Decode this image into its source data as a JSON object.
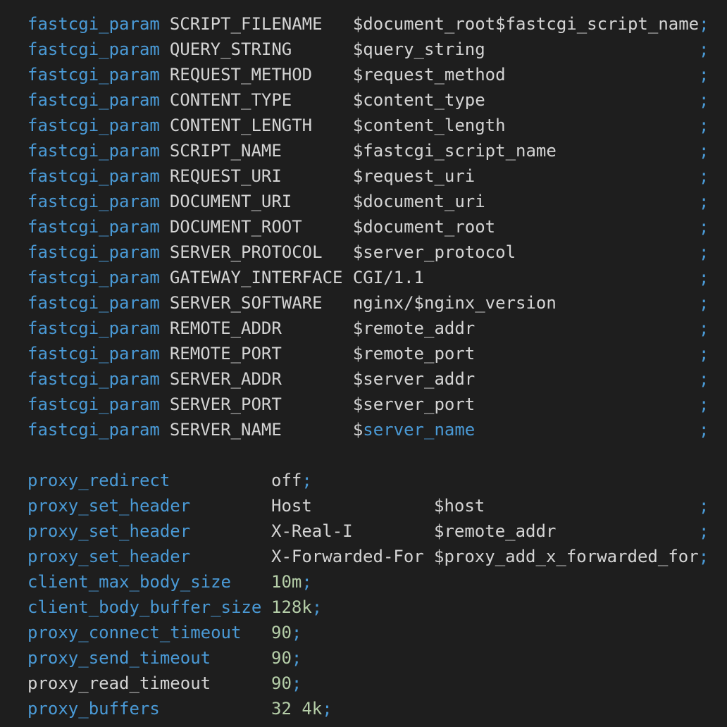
{
  "fastcgi_lines": [
    {
      "directive": "fastcgi_param",
      "name": "SCRIPT_FILENAME",
      "value": "$document_root$fastcgi_script_name",
      "semi": ";"
    },
    {
      "directive": "fastcgi_param",
      "name": "QUERY_STRING",
      "value": "$query_string",
      "semi": ";"
    },
    {
      "directive": "fastcgi_param",
      "name": "REQUEST_METHOD",
      "value": "$request_method",
      "semi": ";"
    },
    {
      "directive": "fastcgi_param",
      "name": "CONTENT_TYPE",
      "value": "$content_type",
      "semi": ";"
    },
    {
      "directive": "fastcgi_param",
      "name": "CONTENT_LENGTH",
      "value": "$content_length",
      "semi": ";"
    },
    {
      "directive": "fastcgi_param",
      "name": "SCRIPT_NAME",
      "value": "$fastcgi_script_name",
      "semi": ";"
    },
    {
      "directive": "fastcgi_param",
      "name": "REQUEST_URI",
      "value": "$request_uri",
      "semi": ";"
    },
    {
      "directive": "fastcgi_param",
      "name": "DOCUMENT_URI",
      "value": "$document_uri",
      "semi": ";"
    },
    {
      "directive": "fastcgi_param",
      "name": "DOCUMENT_ROOT",
      "value": "$document_root",
      "semi": ";"
    },
    {
      "directive": "fastcgi_param",
      "name": "SERVER_PROTOCOL",
      "value": "$server_protocol",
      "semi": ";"
    },
    {
      "directive": "fastcgi_param",
      "name": "GATEWAY_INTERFACE",
      "value": "CGI/1.1",
      "semi": ";"
    },
    {
      "directive": "fastcgi_param",
      "name": "SERVER_SOFTWARE",
      "value": "nginx/$nginx_version",
      "semi": ";"
    },
    {
      "directive": "fastcgi_param",
      "name": "REMOTE_ADDR",
      "value": "$remote_addr",
      "semi": ";"
    },
    {
      "directive": "fastcgi_param",
      "name": "REMOTE_PORT",
      "value": "$remote_port",
      "semi": ";"
    },
    {
      "directive": "fastcgi_param",
      "name": "SERVER_ADDR",
      "value": "$server_addr",
      "semi": ";"
    },
    {
      "directive": "fastcgi_param",
      "name": "SERVER_PORT",
      "value": "$server_port",
      "semi": ";"
    },
    {
      "directive": "fastcgi_param",
      "name": "SERVER_NAME",
      "value_prefix": "$",
      "value_highlight": "server_name",
      "semi": ";"
    }
  ],
  "proxy_lines": [
    {
      "directive": "proxy_redirect",
      "value": "off",
      "semi": ";"
    },
    {
      "directive": "proxy_set_header",
      "name": "Host",
      "value": "$host",
      "semi": ";"
    },
    {
      "directive": "proxy_set_header",
      "name": "X-Real-I",
      "value": "$remote_addr",
      "semi": ";"
    },
    {
      "directive": "proxy_set_header",
      "name": "X-Forwarded-For",
      "value": "$proxy_add_x_forwarded_for",
      "semi": ";"
    },
    {
      "directive": "client_max_body_size",
      "value": "10m",
      "semi": ";"
    },
    {
      "directive": "client_body_buffer_size",
      "value": "128k",
      "semi": ";"
    },
    {
      "directive": "proxy_connect_timeout",
      "value": "90",
      "semi": ";"
    },
    {
      "directive": "proxy_send_timeout",
      "value": "90",
      "semi": ";"
    },
    {
      "directive": "proxy_read_timeout",
      "value": "90",
      "semi": ";"
    },
    {
      "directive": "proxy_buffers",
      "value": "32 4k",
      "semi": ";"
    }
  ],
  "colors": {
    "background": "#1e1e1e",
    "keyword": "#4a9ad6",
    "text": "#d4d4d4",
    "number": "#b5cea8"
  }
}
